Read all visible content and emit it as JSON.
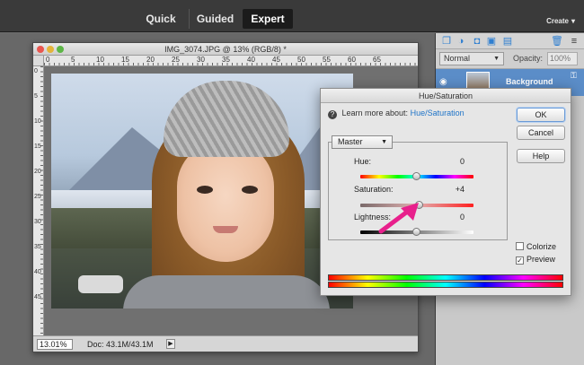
{
  "topbar": {
    "modes": [
      "Quick",
      "Guided",
      "Expert"
    ],
    "active_mode": "Expert",
    "create_label": "Create",
    "create_caret": "▾"
  },
  "document": {
    "title": "IMG_3074.JPG @ 13% (RGB/8) *",
    "ruler_ticks": [
      "0",
      "5",
      "10",
      "15",
      "20",
      "25",
      "30",
      "35",
      "40",
      "45",
      "50",
      "55",
      "60",
      "65"
    ],
    "ruler_left_ticks": [
      "0",
      "5",
      "10",
      "15",
      "20",
      "25",
      "30",
      "35",
      "40",
      "45"
    ],
    "zoom": "13.01%",
    "doc_info": "Doc: 43.1M/43.1M",
    "status_arrow": "▶"
  },
  "layers_panel": {
    "blend_mode": "Normal",
    "opacity_label": "Opacity:",
    "opacity_value": "100%",
    "layer_name": "Background",
    "icons": [
      "new-layer-icon",
      "adjustment-layer-icon",
      "mask-icon",
      "lock-icon",
      "trash-icon",
      "panel-menu-icon"
    ]
  },
  "hue_saturation": {
    "title": "Hue/Saturation",
    "learn_prefix": "Learn more about:",
    "learn_link": "Hue/Saturation",
    "ok_label": "OK",
    "cancel_label": "Cancel",
    "help_label": "Help",
    "edit_range": "Master",
    "sliders": [
      {
        "label": "Hue:",
        "value": "0",
        "position": 0.5
      },
      {
        "label": "Saturation:",
        "value": "+4",
        "position": 0.52
      },
      {
        "label": "Lightness:",
        "value": "0",
        "position": 0.5
      }
    ],
    "colorize_label": "Colorize",
    "colorize_checked": false,
    "preview_label": "Preview",
    "preview_checked": true
  },
  "colors": {
    "annotation_arrow": "#e8208c",
    "link": "#1f74c8",
    "layer_selected": "#5b8dc8"
  }
}
